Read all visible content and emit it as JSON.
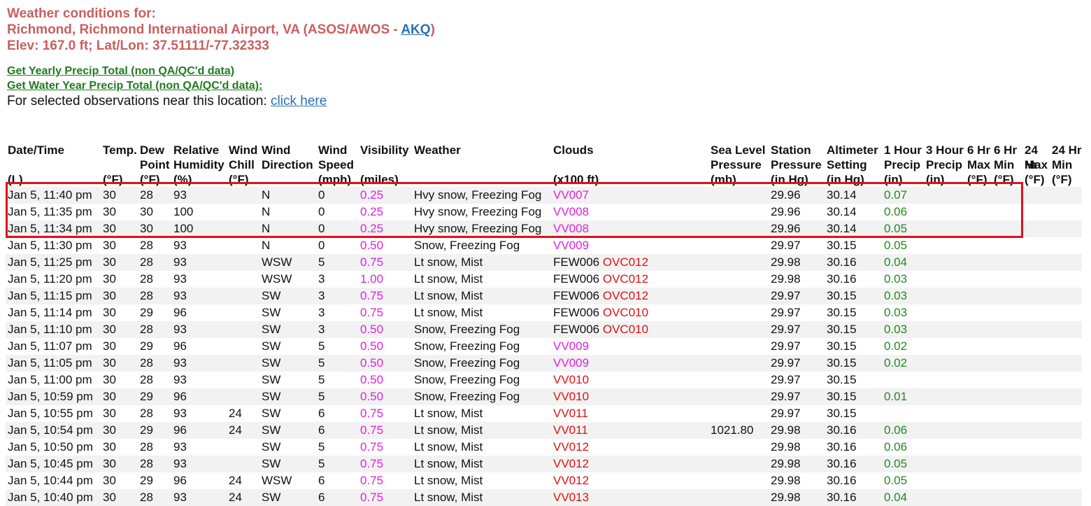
{
  "header": {
    "line1": "Weather conditions for:",
    "line2_prefix": "Richmond, Richmond International Airport, VA (ASOS/AWOS - ",
    "line2_link": "AKQ",
    "line2_suffix": ")",
    "line3": "Elev: 167.0 ft; Lat/Lon: 37.51111/-77.32333"
  },
  "links": {
    "yearly": "Get Yearly Precip Total (non QA/QC'd data)",
    "water_year": "Get Water Year Precip Total (non QA/QC'd data):",
    "selected_text": "For selected observations near this location: ",
    "click_here": "click here"
  },
  "table": {
    "columns": [
      {
        "l1": "Date/Time",
        "l2": "",
        "l3": "(L)"
      },
      {
        "l1": "Temp.",
        "l2": "",
        "l3": "(°F)"
      },
      {
        "l1": "Dew",
        "l2": "Point",
        "l3": "(°F)"
      },
      {
        "l1": "Relative",
        "l2": "Humidity",
        "l3": "(%)"
      },
      {
        "l1": "Wind",
        "l2": "Chill",
        "l3": "(°F)"
      },
      {
        "l1": "Wind",
        "l2": "Direction",
        "l3": ""
      },
      {
        "l1": "Wind",
        "l2": "Speed",
        "l3": "(mph)"
      },
      {
        "l1": "Visibility",
        "l2": "",
        "l3": "(miles)"
      },
      {
        "l1": "Weather",
        "l2": "",
        "l3": ""
      },
      {
        "l1": "Clouds",
        "l2": "",
        "l3": "(x100 ft)"
      },
      {
        "l1": "Sea Level",
        "l2": "Pressure",
        "l3": "(mb)"
      },
      {
        "l1": "Station",
        "l2": "Pressure",
        "l3": "(in Hg)"
      },
      {
        "l1": "Altimeter",
        "l2": "Setting",
        "l3": "(in Hg)"
      },
      {
        "l1": "1 Hour",
        "l2": "Precip",
        "l3": "(in)"
      },
      {
        "l1": "3 Hour",
        "l2": "Precip",
        "l3": "(in)"
      },
      {
        "l1": "6 Hr",
        "l2": "Max",
        "l3": "(°F)"
      },
      {
        "l1": "6 Hr",
        "l2": "Min",
        "l3": "(°F)"
      },
      {
        "l1": "24 Hr",
        "l2": "Max",
        "l3": "(°F)"
      },
      {
        "l1": "24 Hr",
        "l2": "Min",
        "l3": "(°F)"
      }
    ],
    "rows": [
      {
        "dt": "Jan 5, 11:40 pm",
        "temp": "30",
        "dew": "28",
        "rh": "93",
        "chill": "",
        "dir": "N",
        "spd": "0",
        "vis": "0.25",
        "wx": "Hvy snow, Freezing Fog",
        "c1": "VV007",
        "c1cls": "vv",
        "c2": "",
        "slp": "",
        "stp": "29.96",
        "alt": "30.14",
        "p1": "0.07"
      },
      {
        "dt": "Jan 5, 11:35 pm",
        "temp": "30",
        "dew": "30",
        "rh": "100",
        "chill": "",
        "dir": "N",
        "spd": "0",
        "vis": "0.25",
        "wx": "Hvy snow, Freezing Fog",
        "c1": "VV008",
        "c1cls": "vv",
        "c2": "",
        "slp": "",
        "stp": "29.96",
        "alt": "30.14",
        "p1": "0.06"
      },
      {
        "dt": "Jan 5, 11:34 pm",
        "temp": "30",
        "dew": "30",
        "rh": "100",
        "chill": "",
        "dir": "N",
        "spd": "0",
        "vis": "0.25",
        "wx": "Hvy snow, Freezing Fog",
        "c1": "VV008",
        "c1cls": "vv",
        "c2": "",
        "slp": "",
        "stp": "29.96",
        "alt": "30.14",
        "p1": "0.05"
      },
      {
        "dt": "Jan 5, 11:30 pm",
        "temp": "30",
        "dew": "28",
        "rh": "93",
        "chill": "",
        "dir": "N",
        "spd": "0",
        "vis": "0.50",
        "wx": "Snow, Freezing Fog",
        "c1": "VV009",
        "c1cls": "vv",
        "c2": "",
        "slp": "",
        "stp": "29.97",
        "alt": "30.15",
        "p1": "0.05"
      },
      {
        "dt": "Jan 5, 11:25 pm",
        "temp": "30",
        "dew": "28",
        "rh": "93",
        "chill": "",
        "dir": "WSW",
        "spd": "5",
        "vis": "0.75",
        "wx": "Lt snow, Mist",
        "c1": "FEW006",
        "c1cls": "few",
        "c2": "OVC012",
        "slp": "",
        "stp": "29.98",
        "alt": "30.16",
        "p1": "0.04"
      },
      {
        "dt": "Jan 5, 11:20 pm",
        "temp": "30",
        "dew": "28",
        "rh": "93",
        "chill": "",
        "dir": "WSW",
        "spd": "3",
        "vis": "1.00",
        "wx": "Lt snow, Mist",
        "c1": "FEW006",
        "c1cls": "few",
        "c2": "OVC012",
        "slp": "",
        "stp": "29.98",
        "alt": "30.16",
        "p1": "0.03"
      },
      {
        "dt": "Jan 5, 11:15 pm",
        "temp": "30",
        "dew": "28",
        "rh": "93",
        "chill": "",
        "dir": "SW",
        "spd": "3",
        "vis": "0.75",
        "wx": "Lt snow, Mist",
        "c1": "FEW006",
        "c1cls": "few",
        "c2": "OVC012",
        "slp": "",
        "stp": "29.97",
        "alt": "30.15",
        "p1": "0.03"
      },
      {
        "dt": "Jan 5, 11:14 pm",
        "temp": "30",
        "dew": "29",
        "rh": "96",
        "chill": "",
        "dir": "SW",
        "spd": "3",
        "vis": "0.75",
        "wx": "Lt snow, Mist",
        "c1": "FEW006",
        "c1cls": "few",
        "c2": "OVC010",
        "slp": "",
        "stp": "29.97",
        "alt": "30.15",
        "p1": "0.03"
      },
      {
        "dt": "Jan 5, 11:10 pm",
        "temp": "30",
        "dew": "28",
        "rh": "93",
        "chill": "",
        "dir": "SW",
        "spd": "3",
        "vis": "0.50",
        "wx": "Snow, Freezing Fog",
        "c1": "FEW006",
        "c1cls": "few",
        "c2": "OVC010",
        "slp": "",
        "stp": "29.97",
        "alt": "30.15",
        "p1": "0.03"
      },
      {
        "dt": "Jan 5, 11:07 pm",
        "temp": "30",
        "dew": "29",
        "rh": "96",
        "chill": "",
        "dir": "SW",
        "spd": "5",
        "vis": "0.50",
        "wx": "Snow, Freezing Fog",
        "c1": "VV009",
        "c1cls": "vv",
        "c2": "",
        "slp": "",
        "stp": "29.97",
        "alt": "30.15",
        "p1": "0.02"
      },
      {
        "dt": "Jan 5, 11:05 pm",
        "temp": "30",
        "dew": "28",
        "rh": "93",
        "chill": "",
        "dir": "SW",
        "spd": "5",
        "vis": "0.50",
        "wx": "Snow, Freezing Fog",
        "c1": "VV009",
        "c1cls": "vv",
        "c2": "",
        "slp": "",
        "stp": "29.97",
        "alt": "30.15",
        "p1": "0.02"
      },
      {
        "dt": "Jan 5, 11:00 pm",
        "temp": "30",
        "dew": "28",
        "rh": "93",
        "chill": "",
        "dir": "SW",
        "spd": "5",
        "vis": "0.50",
        "wx": "Snow, Freezing Fog",
        "c1": "VV010",
        "c1cls": "vvr",
        "c2": "",
        "slp": "",
        "stp": "29.97",
        "alt": "30.15",
        "p1": ""
      },
      {
        "dt": "Jan 5, 10:59 pm",
        "temp": "30",
        "dew": "29",
        "rh": "96",
        "chill": "",
        "dir": "SW",
        "spd": "5",
        "vis": "0.50",
        "wx": "Snow, Freezing Fog",
        "c1": "VV010",
        "c1cls": "vvr",
        "c2": "",
        "slp": "",
        "stp": "29.97",
        "alt": "30.15",
        "p1": "0.01"
      },
      {
        "dt": "Jan 5, 10:55 pm",
        "temp": "30",
        "dew": "28",
        "rh": "93",
        "chill": "24",
        "dir": "SW",
        "spd": "6",
        "vis": "0.75",
        "wx": "Lt snow, Mist",
        "c1": "VV011",
        "c1cls": "vvr",
        "c2": "",
        "slp": "",
        "stp": "29.97",
        "alt": "30.15",
        "p1": ""
      },
      {
        "dt": "Jan 5, 10:54 pm",
        "temp": "30",
        "dew": "29",
        "rh": "96",
        "chill": "24",
        "dir": "SW",
        "spd": "6",
        "vis": "0.75",
        "wx": "Lt snow, Mist",
        "c1": "VV011",
        "c1cls": "vvr",
        "c2": "",
        "slp": "1021.80",
        "stp": "29.98",
        "alt": "30.16",
        "p1": "0.06"
      },
      {
        "dt": "Jan 5, 10:50 pm",
        "temp": "30",
        "dew": "28",
        "rh": "93",
        "chill": "",
        "dir": "SW",
        "spd": "5",
        "vis": "0.75",
        "wx": "Lt snow, Mist",
        "c1": "VV012",
        "c1cls": "vvr",
        "c2": "",
        "slp": "",
        "stp": "29.98",
        "alt": "30.16",
        "p1": "0.06"
      },
      {
        "dt": "Jan 5, 10:45 pm",
        "temp": "30",
        "dew": "28",
        "rh": "93",
        "chill": "",
        "dir": "SW",
        "spd": "5",
        "vis": "0.75",
        "wx": "Lt snow, Mist",
        "c1": "VV012",
        "c1cls": "vvr",
        "c2": "",
        "slp": "",
        "stp": "29.98",
        "alt": "30.16",
        "p1": "0.05"
      },
      {
        "dt": "Jan 5, 10:44 pm",
        "temp": "30",
        "dew": "29",
        "rh": "96",
        "chill": "24",
        "dir": "WSW",
        "spd": "6",
        "vis": "0.75",
        "wx": "Lt snow, Mist",
        "c1": "VV012",
        "c1cls": "vvr",
        "c2": "",
        "slp": "",
        "stp": "29.98",
        "alt": "30.16",
        "p1": "0.05"
      },
      {
        "dt": "Jan 5, 10:40 pm",
        "temp": "30",
        "dew": "28",
        "rh": "93",
        "chill": "24",
        "dir": "SW",
        "spd": "6",
        "vis": "0.75",
        "wx": "Lt snow, Mist",
        "c1": "VV013",
        "c1cls": "vvr",
        "c2": "",
        "slp": "",
        "stp": "29.98",
        "alt": "30.16",
        "p1": "0.04"
      }
    ]
  },
  "colors": {
    "header": "#c95f5f",
    "link": "#2c6fb4",
    "green_link": "#1f7a1f",
    "visibility": "#e020e0",
    "ovc": "#e01010",
    "highlight": "#e0101a"
  }
}
